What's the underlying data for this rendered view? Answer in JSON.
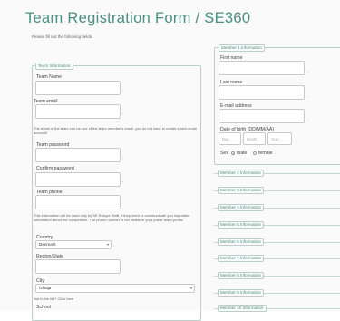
{
  "page_title": "Team Registration Form / SE360",
  "intro_text": "Please fill out the following fields.",
  "team_info": {
    "legend": "Team Information",
    "team_name_label": "Team Name",
    "team_email_label": "Team email",
    "team_email_help": "The email of the team can be one of the team member's email, you do not have to create a new email account!",
    "team_password_label": "Team password",
    "confirm_password_label": "Confirm password",
    "team_phone_label": "Team phone",
    "team_phone_help": "This information will be used only by SE Europe Staff, if they need to communicate you important information about the competition. The phone number is not visible in your public team profile.",
    "country_label": "Country",
    "country_value": "Denmark",
    "region_label": "Region/State",
    "city_label": "City",
    "city_value": "Olbaja",
    "not_in_list": "Not in the list? Click here",
    "school_label": "School"
  },
  "member1": {
    "legend": "Member 1 Information",
    "first_name_label": "First name",
    "last_name_label": "Last name",
    "email_label": "E-mail address",
    "dob_label": "Date of birth (DD/MM/AA)",
    "dob_day": "Day",
    "dob_month": "Month",
    "dob_year": "Year",
    "sex_label": "Sex",
    "male_label": "male",
    "female_label": "female"
  },
  "other_members": [
    "Member 2 Information",
    "Member 3 Information",
    "Member 4 Information",
    "Member 5 Information",
    "Member 6 Information",
    "Member 7 Information",
    "Member 8 Information",
    "Member 9 Information",
    "Member 10 Information"
  ],
  "colors": {
    "accent": "#4a8f7f",
    "border": "#b9cfc8"
  }
}
